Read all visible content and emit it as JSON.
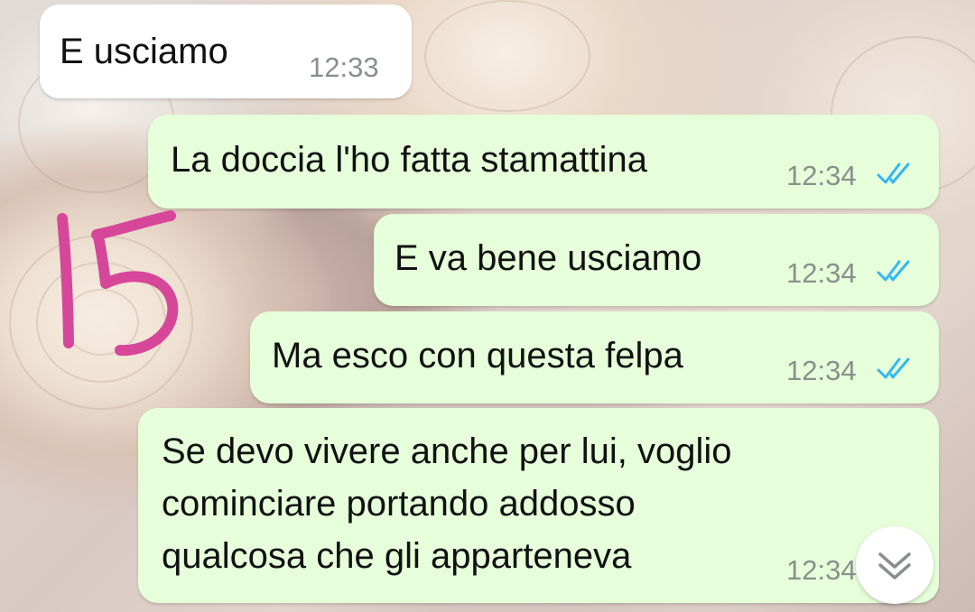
{
  "messages": [
    {
      "direction": "incoming",
      "text": "E usciamo",
      "time": "12:33"
    },
    {
      "direction": "outgoing",
      "text": "La doccia l'ho fatta stamattina",
      "time": "12:34",
      "status": "read"
    },
    {
      "direction": "outgoing",
      "text": "E va bene usciamo",
      "time": "12:34",
      "status": "read"
    },
    {
      "direction": "outgoing",
      "text": "Ma esco con questa felpa",
      "time": "12:34",
      "status": "read"
    },
    {
      "direction": "outgoing",
      "lines": [
        "Se devo vivere anche per lui, voglio",
        "cominciare portando addosso",
        "qualcosa che gli apparteneva"
      ],
      "time": "12:34",
      "status": "read"
    }
  ],
  "annotation": {
    "text": "15",
    "color": "#d6479a"
  },
  "colors": {
    "outgoing_bubble": "#e6ffda",
    "incoming_bubble": "#ffffff",
    "read_ticks": "#34b7f1",
    "timestamp": "#8a8f8c"
  },
  "scroll_button": {
    "icon": "chevron-down-double-icon"
  }
}
